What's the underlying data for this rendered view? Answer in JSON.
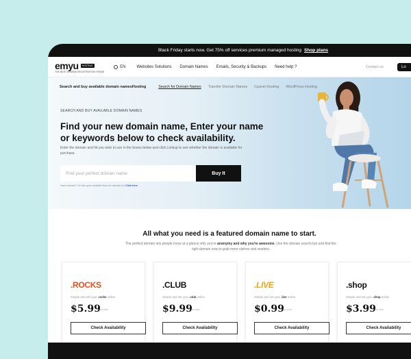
{
  "promo": {
    "text": "Black Friday starts now. Get 75% off services premium managed hosting",
    "link": "Shop plans"
  },
  "header": {
    "logo": "emyu",
    "logo_badge": "HOSTING",
    "logo_tagline": "THE BEST DOMAIN REGISTRATION THEME",
    "language": "EN",
    "menu": [
      "Websites Solutions",
      "Domain Names",
      "Emails, Security & Backups",
      "Need help ?"
    ],
    "contact": "Contact us",
    "login": "Lo"
  },
  "subnav": {
    "title": "Search and buy available domain namesHosting",
    "links": [
      "Search for Domain Names",
      "Transfer Domain Names",
      "Cpanel Hosting",
      "WordPress Hosting"
    ]
  },
  "hero": {
    "eyebrow": "SEARCH AND BUY AVAILABLE DOMAIN NAMES",
    "headline": "Find your new domain name, Enter your name or keywords below to check availability.",
    "description": "Enter the domain and tld you wish to use in the boxes below and click Lookup to see whether the domain is available for purchase.",
    "search_placeholder": "Find your perfect domain name",
    "buy_button": "Buy It",
    "note": "Have domain? Or free your website from her domain for",
    "note_link": "Click here"
  },
  "features": {
    "title": "All what you need is a featured domain name to start.",
    "subtitle_start": "The perfect domain lets people know at a glance why you're",
    "subtitle_bold": "anonymy and why you're awesome",
    "subtitle_end": ". Use the domain search bar and find the right domain now to grab more visitors and readers."
  },
  "cards": [
    {
      "tld": ".ROCKS",
      "desc_start": "Simple and sell your",
      "desc_bold": ".rocks",
      "desc_end": "online",
      "price": "$5.99",
      "period": "per year",
      "button": "Check Availability"
    },
    {
      "tld": ".CLUB",
      "desc_start": "Simple and set your",
      "desc_bold": ".club",
      "desc_end": "online",
      "price": "$9.99",
      "period": "per year",
      "button": "Check Availability"
    },
    {
      "tld": ".LIVE",
      "desc_start": "Simple and set your",
      "desc_bold": ".live",
      "desc_end": "online",
      "price": "$0.99",
      "period": "per year",
      "button": "Check Availability"
    },
    {
      "tld": ".shop",
      "desc_start": "Simple and set your",
      "desc_bold": ".shop",
      "desc_end": "online",
      "price": "$3.99",
      "period": "per year",
      "button": "Check Availability"
    }
  ],
  "colors": {
    "background": "#c6ecec",
    "dark": "#111111",
    "rocks": "#e8501e",
    "club": "#111111",
    "club_dot": "#2d6de5",
    "live": "#f2a314",
    "shop": "#111111",
    "shop_dot": "#1f8f4a",
    "link": "#3a58c8"
  },
  "icons": {
    "language": "globe-icon"
  }
}
